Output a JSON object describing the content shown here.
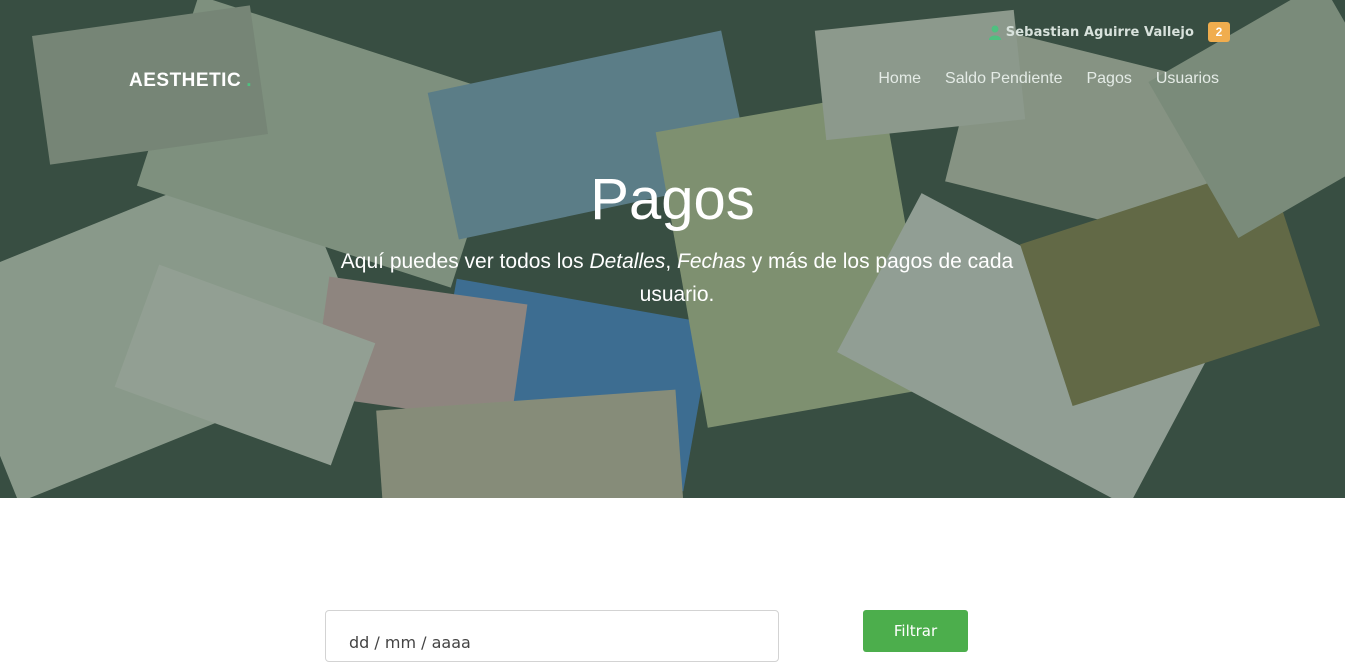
{
  "header": {
    "user_name": "Sebastian Aguirre Vallejo",
    "notification_count": "2",
    "brand": "AESTHETIC",
    "brand_dot": ".",
    "nav": [
      {
        "label": "Home"
      },
      {
        "label": "Saldo Pendiente"
      },
      {
        "label": "Pagos"
      },
      {
        "label": "Usuarios"
      }
    ]
  },
  "hero": {
    "title": "Pagos",
    "subtitle_part1": "Aquí puedes ver todos los ",
    "subtitle_em1": "Detalles",
    "subtitle_sep": ", ",
    "subtitle_em2": "Fechas",
    "subtitle_part2": " y más de los pagos de cada usuario."
  },
  "filter": {
    "date_placeholder": "dd / mm / aaaa",
    "button_label": "Filtrar"
  },
  "colors": {
    "accent_green": "#4fc080",
    "button_green": "#4cae4c",
    "badge_orange": "#f0ad4e"
  }
}
